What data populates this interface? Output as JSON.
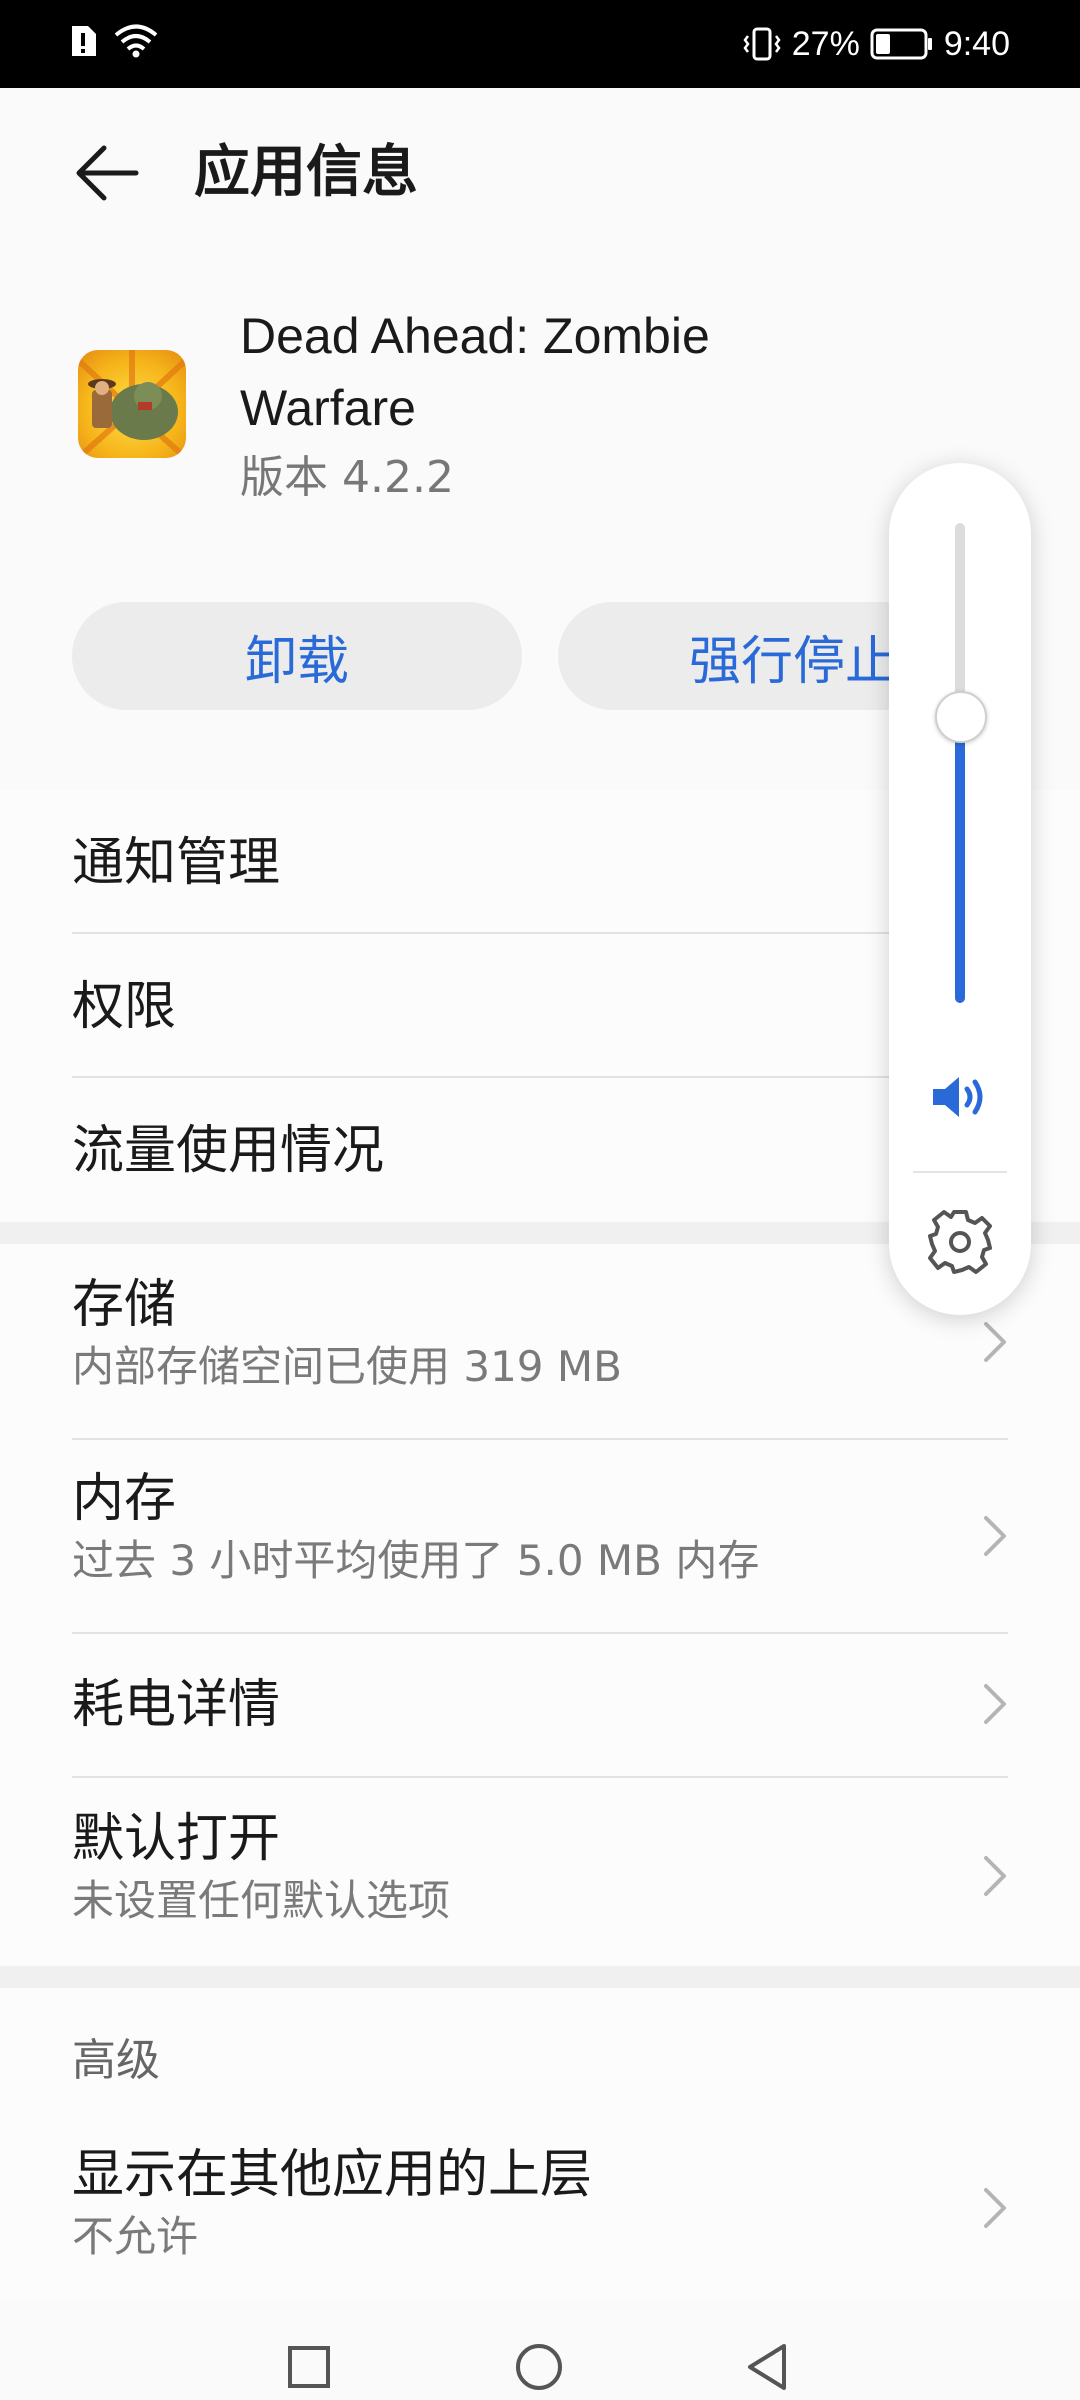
{
  "status_bar": {
    "battery_percent": "27%",
    "time": "9:40",
    "icons": [
      "alert-icon",
      "wifi-icon",
      "vibrate-icon",
      "battery-icon"
    ]
  },
  "header": {
    "title": "应用信息",
    "back_icon": "back-arrow-icon"
  },
  "app": {
    "name": "Dead Ahead: Zombie Warfare",
    "version": "版本 4.2.2"
  },
  "buttons": {
    "uninstall": "卸载",
    "force_stop": "强行停止"
  },
  "group1": [
    {
      "title": "通知管理"
    },
    {
      "title": "权限"
    },
    {
      "title": "流量使用情况"
    }
  ],
  "group2": [
    {
      "title": "存储",
      "subtitle": "内部存储空间已使用 319 MB"
    },
    {
      "title": "内存",
      "subtitle": "过去 3 小时平均使用了 5.0 MB 内存"
    },
    {
      "title": "耗电详情"
    },
    {
      "title": "默认打开",
      "subtitle": "未设置任何默认选项"
    }
  ],
  "advanced": {
    "label": "高级",
    "items": [
      {
        "title": "显示在其他应用的上层",
        "subtitle": "不允许"
      }
    ]
  },
  "volume_panel": {
    "level_fraction": 0.6,
    "icons": [
      "speaker-icon",
      "gear-icon"
    ]
  },
  "nav_bar": {
    "icons": [
      "recents-square-icon",
      "home-circle-icon",
      "back-triangle-icon"
    ]
  },
  "colors": {
    "accent": "#2a6ad8",
    "background": "#fafafa",
    "status_bar": "#000000"
  }
}
